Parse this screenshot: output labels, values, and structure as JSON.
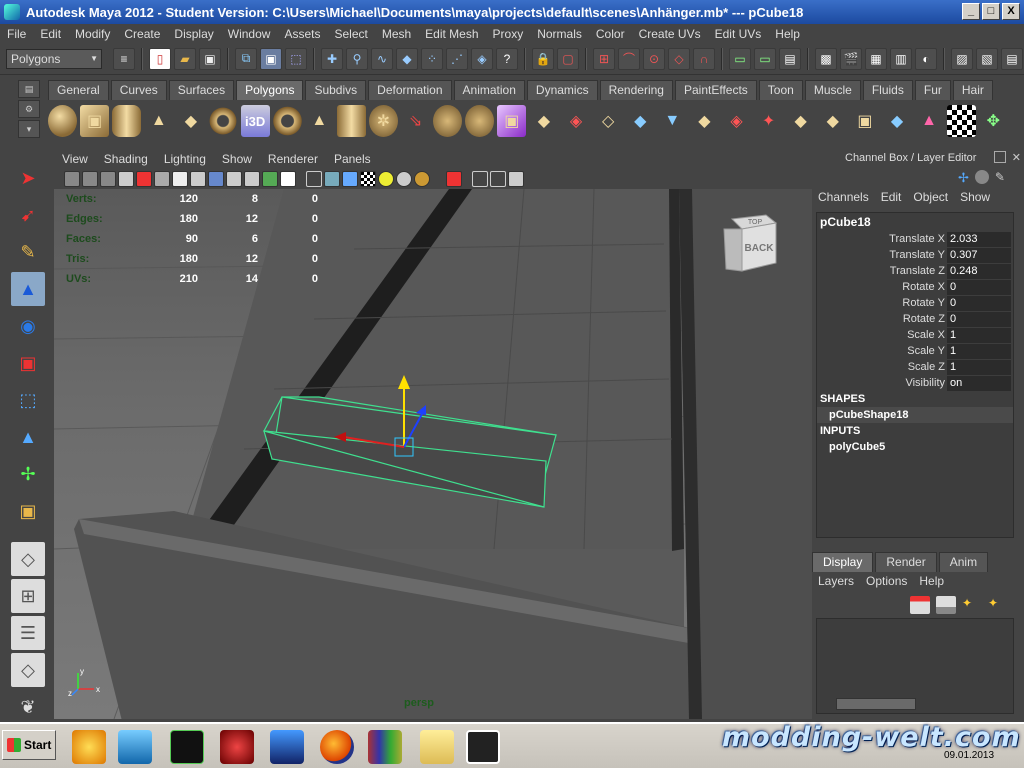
{
  "window": {
    "title": "Autodesk Maya 2012 - Student Version: C:\\Users\\Michael\\Documents\\maya\\projects\\default\\scenes\\Anhänger.mb*   ---   pCube18",
    "buttons": [
      "_",
      "□",
      "X"
    ]
  },
  "menubar": [
    "File",
    "Edit",
    "Modify",
    "Create",
    "Display",
    "Window",
    "Assets",
    "Select",
    "Mesh",
    "Edit Mesh",
    "Proxy",
    "Normals",
    "Color",
    "Create UVs",
    "Edit UVs",
    "Help"
  ],
  "statusline": {
    "mode": "Polygons"
  },
  "shelf": {
    "tabs": [
      "General",
      "Curves",
      "Surfaces",
      "Polygons",
      "Subdivs",
      "Deformation",
      "Animation",
      "Dynamics",
      "Rendering",
      "PaintEffects",
      "Toon",
      "Muscle",
      "Fluids",
      "Fur",
      "Hair"
    ],
    "active_tab": "Polygons",
    "i3d_label": "i3D"
  },
  "viewport": {
    "menus": [
      "View",
      "Shading",
      "Lighting",
      "Show",
      "Renderer",
      "Panels"
    ],
    "hud": [
      {
        "label": "Verts:",
        "a": "120",
        "b": "8",
        "c": "0"
      },
      {
        "label": "Edges:",
        "a": "180",
        "b": "12",
        "c": "0"
      },
      {
        "label": "Faces:",
        "a": "90",
        "b": "6",
        "c": "0"
      },
      {
        "label": "Tris:",
        "a": "180",
        "b": "12",
        "c": "0"
      },
      {
        "label": "UVs:",
        "a": "210",
        "b": "14",
        "c": "0"
      }
    ],
    "viewcube_top": "TOP",
    "viewcube_face": "BACK",
    "camera": "persp",
    "axis_x": "x",
    "axis_y": "y",
    "axis_z": "z",
    "selection_color": "#3fe08f"
  },
  "channel_box": {
    "header": "Channel Box / Layer Editor",
    "menus": [
      "Channels",
      "Edit",
      "Object",
      "Show"
    ],
    "object": "pCube18",
    "channels": [
      {
        "name": "Translate X",
        "value": "2.033"
      },
      {
        "name": "Translate Y",
        "value": "0.307"
      },
      {
        "name": "Translate Z",
        "value": "0.248"
      },
      {
        "name": "Rotate X",
        "value": "0"
      },
      {
        "name": "Rotate Y",
        "value": "0"
      },
      {
        "name": "Rotate Z",
        "value": "0"
      },
      {
        "name": "Scale X",
        "value": "1"
      },
      {
        "name": "Scale Y",
        "value": "1"
      },
      {
        "name": "Scale Z",
        "value": "1"
      },
      {
        "name": "Visibility",
        "value": "on"
      }
    ],
    "shapes_label": "SHAPES",
    "shape": "pCubeShape18",
    "inputs_label": "INPUTS",
    "input": "polyCube5"
  },
  "layer_editor": {
    "tabs": [
      "Display",
      "Render",
      "Anim"
    ],
    "active_tab": "Display",
    "menus": [
      "Layers",
      "Options",
      "Help"
    ]
  },
  "taskbar": {
    "start_label": "Start",
    "clock_date": "09.01.2013"
  },
  "watermark": "modding-welt.com"
}
